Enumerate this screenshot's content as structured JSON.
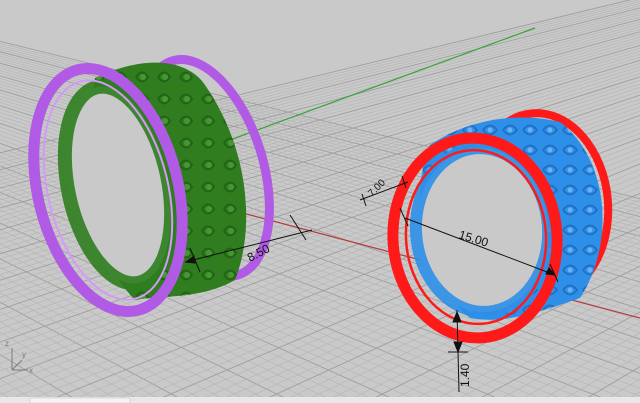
{
  "viewport": {
    "background": "#c9c9c9",
    "grid_minor_color": "#b4b4b4",
    "grid_major_color": "#9e9e9e",
    "axis_x_color": "#b23b3b",
    "axis_y_color": "#3aa53a"
  },
  "objects": {
    "left_ring": {
      "outer_rail_color": "#b05ae6",
      "filigree_color": "#2f7d1f"
    },
    "right_ring": {
      "outer_rail_color": "#ff1a1a",
      "filigree_color": "#2e8fe8"
    }
  },
  "dimensions": {
    "left_width": "8.50",
    "right_depth": "7.00",
    "right_diameter": "15.00",
    "right_thickness": "1.40"
  },
  "axis_gizmo": {
    "x_label": "x",
    "y_label": "y",
    "z_label": "z"
  }
}
